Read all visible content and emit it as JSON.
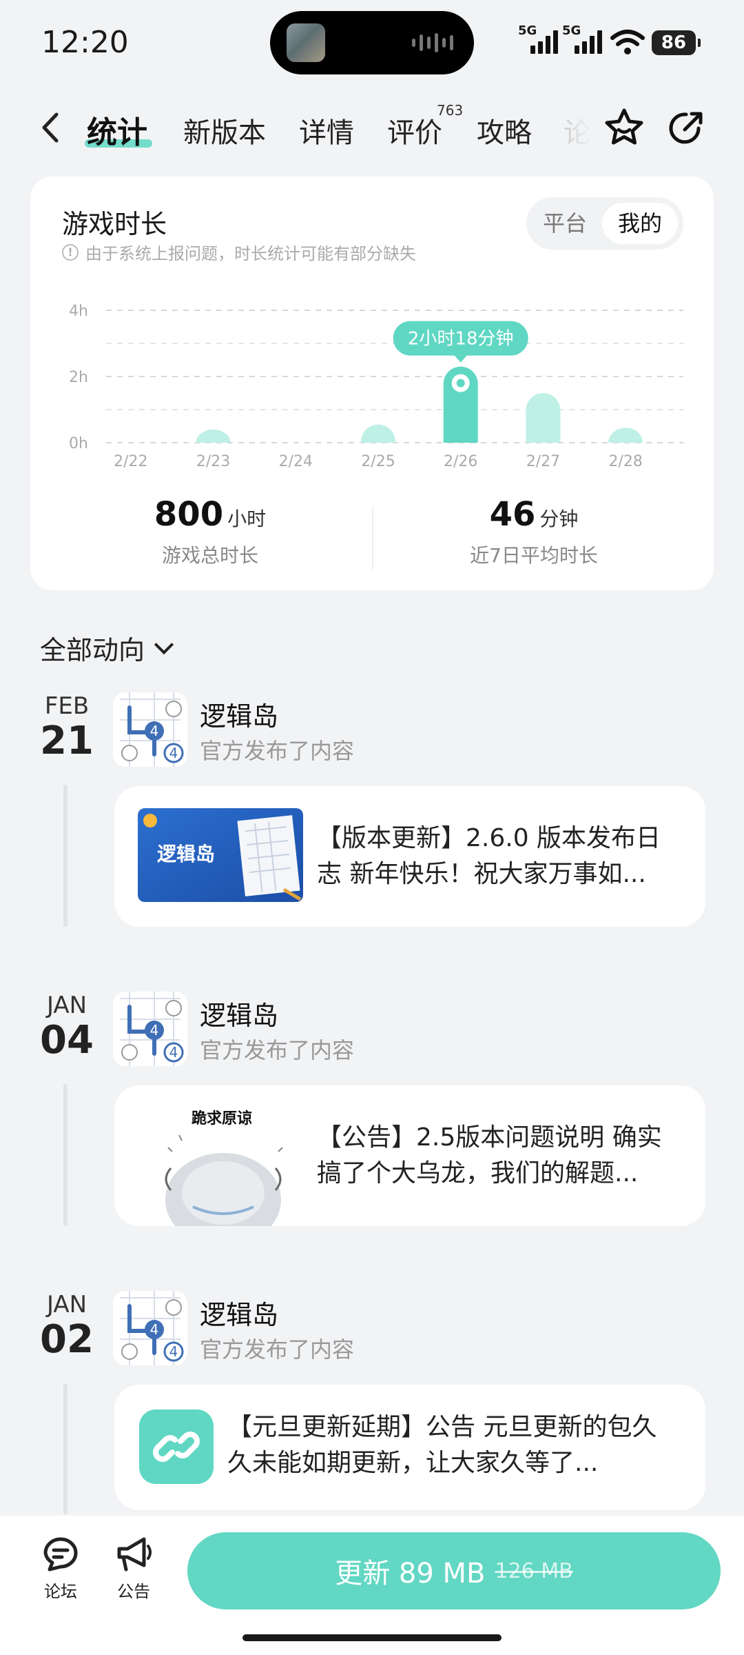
{
  "status": {
    "time": "12:20",
    "net1": "5G",
    "net2": "5G",
    "battery": "86"
  },
  "nav": {
    "tabs": [
      "统计",
      "新版本",
      "详情",
      "评价",
      "攻略",
      "论"
    ],
    "review_count": "763",
    "icons": [
      "back-icon",
      "star-icon",
      "share-icon"
    ]
  },
  "stats": {
    "title": "游戏时长",
    "note": "由于系统上报问题，时长统计可能有部分缺失",
    "toggle": [
      "平台",
      "我的"
    ],
    "total_value": "800",
    "total_unit": "小时",
    "total_label": "游戏总时长",
    "avg_value": "46",
    "avg_unit": "分钟",
    "avg_label": "近7日平均时长",
    "accent": "#5fd7c3"
  },
  "chart_data": {
    "type": "bar",
    "categories": [
      "2/22",
      "2/23",
      "2/24",
      "2/25",
      "2/26",
      "2/27",
      "2/28"
    ],
    "values": [
      0,
      0.4,
      0,
      0.55,
      2.3,
      1.5,
      0.45
    ],
    "highlight_index": 4,
    "tooltip": "2小时18分钟",
    "yticks": [
      "4h",
      "2h",
      "0h"
    ],
    "ylim": [
      0,
      4
    ]
  },
  "feed": {
    "filter_label": "全部动向",
    "items": [
      {
        "month": "FEB",
        "day": "21",
        "name": "逻辑岛",
        "action": "官方发布了内容",
        "thumb": "game-banner",
        "banner_text": "逻辑岛",
        "text": "【版本更新】2.6.0 版本发布日志 新年快乐！祝大家万事如..."
      },
      {
        "month": "JAN",
        "day": "04",
        "name": "逻辑岛",
        "action": "官方发布了内容",
        "thumb": "sticker",
        "caption": "跪求原谅",
        "text": "【公告】2.5版本问题说明 确实搞了个大乌龙，我们的解题..."
      },
      {
        "month": "JAN",
        "day": "02",
        "name": "逻辑岛",
        "action": "官方发布了内容",
        "thumb": "link-icon",
        "text": "【元旦更新延期】公告 元旦更新的包久久未能如期更新，让大家久等了..."
      }
    ]
  },
  "bottom": {
    "forum": "论坛",
    "notice": "公告",
    "update": "更新 89 MB",
    "old_size": "126 MB"
  }
}
